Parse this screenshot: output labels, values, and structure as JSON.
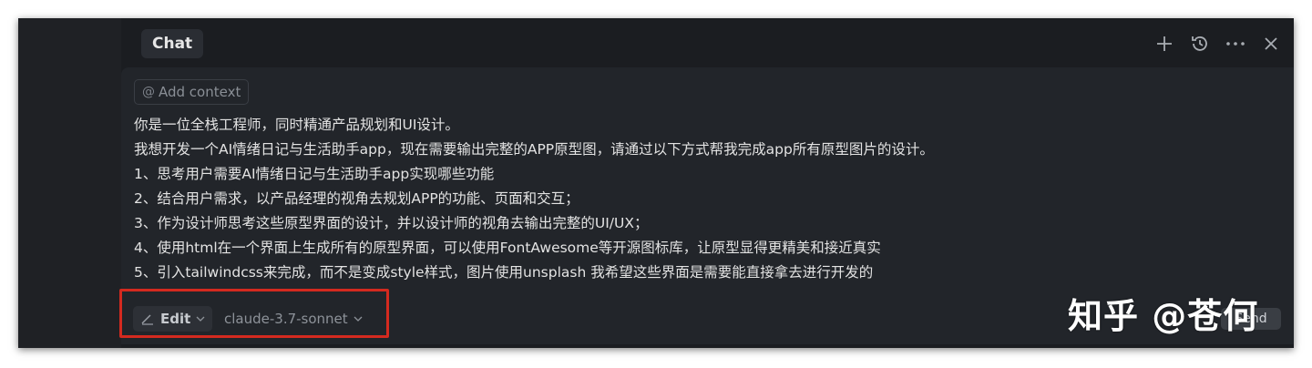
{
  "header": {
    "tab_label": "Chat",
    "icons": [
      "plus-icon",
      "history-icon",
      "more-icon",
      "close-icon"
    ]
  },
  "composer": {
    "add_context_label": "Add context",
    "prompt_lines": [
      "你是一位全栈工程师，同时精通产品规划和UI设计。",
      "我想开发一个AI情绪日记与生活助手app，现在需要输出完整的APP原型图，请通过以下方式帮我完成app所有原型图片的设计。",
      "1、思考用户需要AI情绪日记与生活助手app实现哪些功能",
      "2、结合用户需求，以产品经理的视角去规划APP的功能、页面和交互；",
      "3、作为设计师思考这些原型界面的设计，并以设计师的视角去输出完整的UI/UX；",
      "4、使用html在一个界面上生成所有的原型界面，可以使用FontAwesome等开源图标库，让原型显得更精美和接近真实",
      "5、引入tailwindcss来完成，而不是变成style样式，图片使用unsplash 我希望这些界面是需要能直接拿去进行开发的"
    ],
    "mode_label": "Edit",
    "model_label": "claude-3.7-sonnet",
    "send_label": "Send"
  },
  "watermark": "知乎 @苍何",
  "colors": {
    "background": "#1b1d21",
    "panel": "#22252a",
    "highlight_border": "#d42a1f"
  }
}
